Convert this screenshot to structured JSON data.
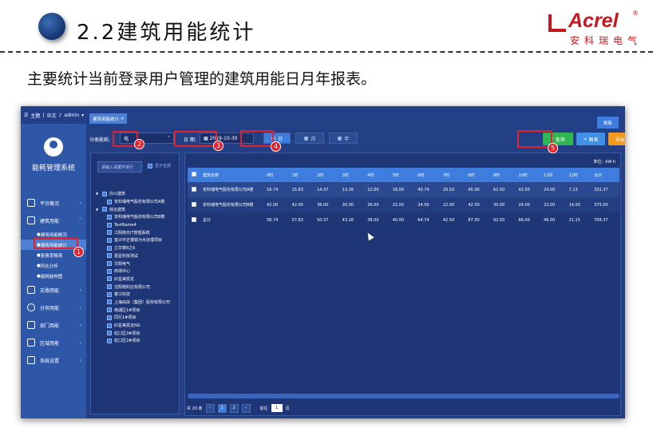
{
  "header": {
    "title": "2.2建筑用能统计"
  },
  "logo": {
    "word": "Acrel",
    "reg": "®",
    "chinese": "安科瑞电气"
  },
  "subtitle": "主要统计当前登录用户管理的建筑用能日月年报表。",
  "app": {
    "topbar": {
      "theme": "主题",
      "lang": "中文",
      "user": "admin"
    },
    "system_name": "能耗管理系统",
    "sidebar": [
      {
        "label": "平台概况"
      },
      {
        "label": "建筑用能"
      },
      {
        "label": "支路用能"
      },
      {
        "label": "分项用能"
      },
      {
        "label": "部门用能"
      },
      {
        "label": "区域用能"
      },
      {
        "label": "系统设置"
      }
    ],
    "sidebar_sub": [
      "建筑用能概况",
      "建筑用能统计",
      "复费率报表",
      "同比分析",
      "能耗结构图"
    ],
    "tab": "建筑用能统计",
    "refresh": "刷新",
    "filter": {
      "type_label": "分类能耗:",
      "type_value": "电",
      "date_label": "日 期:",
      "date_value": "2019-10-30",
      "day_btn": "日",
      "month_btn": "月",
      "year_btn": "年",
      "query": "查询",
      "chart": "图表",
      "export": "导出"
    },
    "tree": {
      "search_placeholder": "请输入关键字进行",
      "show_all": "显示全部",
      "nodes": [
        {
          "label": "办公建筑",
          "level": 0
        },
        {
          "label": "安科瑞电气股份有限公司A楼",
          "level": 1
        },
        {
          "label": "综合建筑",
          "level": 0
        },
        {
          "label": "安科瑞电气股份有限公司B楼",
          "level": 1
        },
        {
          "label": "TestName4",
          "level": 1
        },
        {
          "label": "江阴南光IT管理系统",
          "level": 1
        },
        {
          "label": "宜兴中正钢铁污水处理项目",
          "level": 1
        },
        {
          "label": "立华楼8之6",
          "level": 1
        },
        {
          "label": "嘉星科技测试",
          "level": 1
        },
        {
          "label": "华阳电气",
          "level": 1
        },
        {
          "label": "商场中心",
          "level": 1
        },
        {
          "label": "红星美凯龙",
          "level": 1
        },
        {
          "label": "沈阳塔利达有限公司",
          "level": 1
        },
        {
          "label": "泰江科技",
          "level": 1
        },
        {
          "label": "上海由由（集团）股份有限公司",
          "level": 1
        },
        {
          "label": "南湖区1#项目",
          "level": 1
        },
        {
          "label": "同行1#项目",
          "level": 1
        },
        {
          "label": "红星美凯龙NG",
          "level": 1
        },
        {
          "label": "虹口区3#项目",
          "level": 1
        },
        {
          "label": "虹口区2#项目",
          "level": 1
        }
      ]
    },
    "table": {
      "unit": "单位：kW·h",
      "headers": [
        "建筑名称",
        "0时",
        "1时",
        "2时",
        "3时",
        "4时",
        "5时",
        "6时",
        "7时",
        "8时",
        "9时",
        "10时",
        "11时",
        "12时",
        "合计"
      ],
      "rows": [
        [
          "安科瑞电气股份有限公司A楼",
          "16.74",
          "15.63",
          "14.37",
          "13.26",
          "12.00",
          "18.00",
          "40.74",
          "20.50",
          "45.00",
          "62.50",
          "42.00",
          "24.00",
          "7.13",
          "332.37"
        ],
        [
          "安科瑞电气股份有限公司B楼",
          "42.00",
          "42.00",
          "36.00",
          "30.00",
          "26.00",
          "22.00",
          "24.00",
          "22.00",
          "42.50",
          "30.00",
          "24.00",
          "22.00",
          "14.00",
          "375.00"
        ],
        [
          "总计",
          "58.74",
          "57.63",
          "50.37",
          "43.26",
          "38.00",
          "40.00",
          "64.74",
          "42.50",
          "87.50",
          "92.50",
          "66.00",
          "46.00",
          "21.15",
          "708.37"
        ]
      ]
    },
    "pager": {
      "total": "共 20 条",
      "pages": [
        "1",
        "2"
      ],
      "goto": "前往",
      "page_input": "1",
      "page_unit": "页"
    }
  },
  "callouts": [
    "1",
    "2",
    "3",
    "4",
    "5"
  ]
}
